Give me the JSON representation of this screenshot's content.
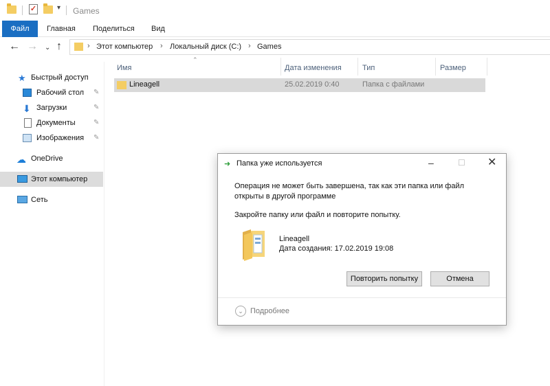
{
  "window": {
    "title": "Games"
  },
  "ribbon": {
    "tabs": [
      "Файл",
      "Главная",
      "Поделиться",
      "Вид"
    ]
  },
  "address": {
    "crumbs": [
      "Этот компьютер",
      "Локальный диск (C:)",
      "Games"
    ]
  },
  "sidebar": {
    "items": [
      {
        "label": "Быстрый доступ",
        "icon": "star-icon"
      },
      {
        "label": "Рабочий стол",
        "icon": "desktop-icon",
        "pinned": true
      },
      {
        "label": "Загрузки",
        "icon": "download-icon",
        "pinned": true
      },
      {
        "label": "Документы",
        "icon": "documents-icon",
        "pinned": true
      },
      {
        "label": "Изображения",
        "icon": "pictures-icon",
        "pinned": true
      },
      {
        "label": "OneDrive",
        "icon": "cloud-icon"
      },
      {
        "label": "Этот компьютер",
        "icon": "computer-icon",
        "selected": true
      },
      {
        "label": "Сеть",
        "icon": "network-icon"
      }
    ]
  },
  "filelist": {
    "columns": [
      "Имя",
      "Дата изменения",
      "Тип",
      "Размер"
    ],
    "rows": [
      {
        "name": "Lineagell",
        "modified": "25.02.2019 0:40",
        "type": "Папка с файлами",
        "size": ""
      }
    ]
  },
  "dialog": {
    "title": "Папка уже используется",
    "message_line1": "Операция не может быть завершена, так как эти папка или файл",
    "message_line2": "открыты в другой программе",
    "hint": "Закройте папку или файл и повторите попытку.",
    "item_name": "Lineagell",
    "item_created": "Дата создания: 17.02.2019 19:08",
    "retry_label": "Повторить попытку",
    "cancel_label": "Отмена",
    "more_label": "Подробнее"
  },
  "colors": {
    "accent": "#1a6ec2",
    "folder": "#f4cd63",
    "selection": "#d9d9d9"
  }
}
